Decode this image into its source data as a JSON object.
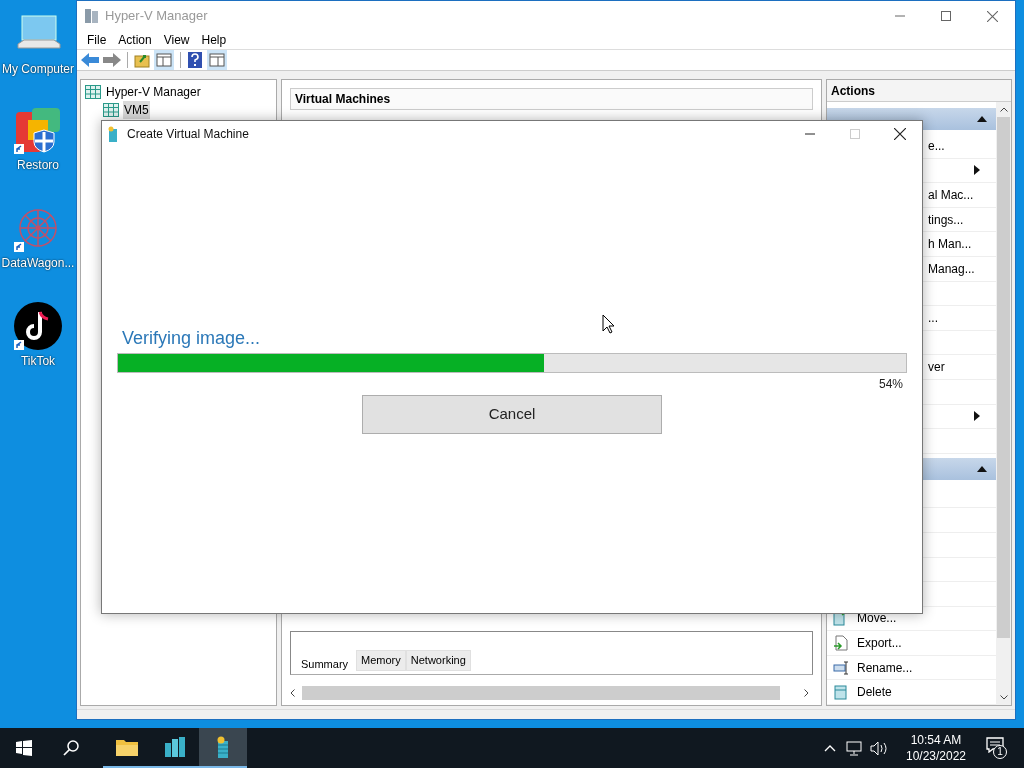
{
  "desktop_icons": [
    {
      "label": "My Computer",
      "kind": "computer"
    },
    {
      "label": "Restoro",
      "kind": "restoro"
    },
    {
      "label": "DataWagon...",
      "kind": "web"
    },
    {
      "label": "TikTok",
      "kind": "note"
    }
  ],
  "window": {
    "title": "Hyper-V Manager"
  },
  "menu": [
    "File",
    "Action",
    "View",
    "Help"
  ],
  "tree": [
    {
      "label": "Hyper-V Manager",
      "selected": false,
      "children": [
        {
          "label": "VM5",
          "selected": true
        }
      ]
    }
  ],
  "center": {
    "title": "Virtual Machines",
    "tabs": [
      {
        "label": "Summary",
        "selected": true
      },
      {
        "label": "Memory",
        "selected": false
      },
      {
        "label": "Networking",
        "selected": false
      }
    ]
  },
  "actions": {
    "title": "Actions",
    "items": [
      {
        "kind": "header"
      },
      {
        "kind": "item",
        "label": "e..."
      },
      {
        "kind": "submenu"
      },
      {
        "kind": "item",
        "label": "al Mac..."
      },
      {
        "kind": "item",
        "label": "tings..."
      },
      {
        "kind": "item",
        "label": "h Man..."
      },
      {
        "kind": "item",
        "label": "Manag..."
      },
      {
        "kind": "blank"
      },
      {
        "kind": "item",
        "label": "..."
      },
      {
        "kind": "blank"
      },
      {
        "kind": "item",
        "label": "ver"
      },
      {
        "kind": "blank"
      },
      {
        "kind": "submenu"
      },
      {
        "kind": "blank"
      },
      {
        "kind": "header"
      },
      {
        "kind": "blank"
      },
      {
        "kind": "blank"
      },
      {
        "kind": "blank"
      },
      {
        "kind": "blank"
      },
      {
        "kind": "blank"
      },
      {
        "kind": "move",
        "label": "Move..."
      },
      {
        "kind": "export",
        "label": "Export..."
      },
      {
        "kind": "rename",
        "label": "Rename..."
      },
      {
        "kind": "delete",
        "label": "Delete"
      }
    ]
  },
  "dialog": {
    "title": "Create Virtual Machine",
    "status": "Verifying image...",
    "level": 0.54,
    "percent": "54%",
    "button": "Cancel"
  },
  "taskbar": {
    "apps": [
      {
        "kind": "folder",
        "selected": false
      },
      {
        "kind": "servers",
        "selected": false
      },
      {
        "kind": "vm",
        "selected": true
      }
    ],
    "time": "10:54 AM",
    "date": "10/23/2022",
    "notifications": "1"
  }
}
